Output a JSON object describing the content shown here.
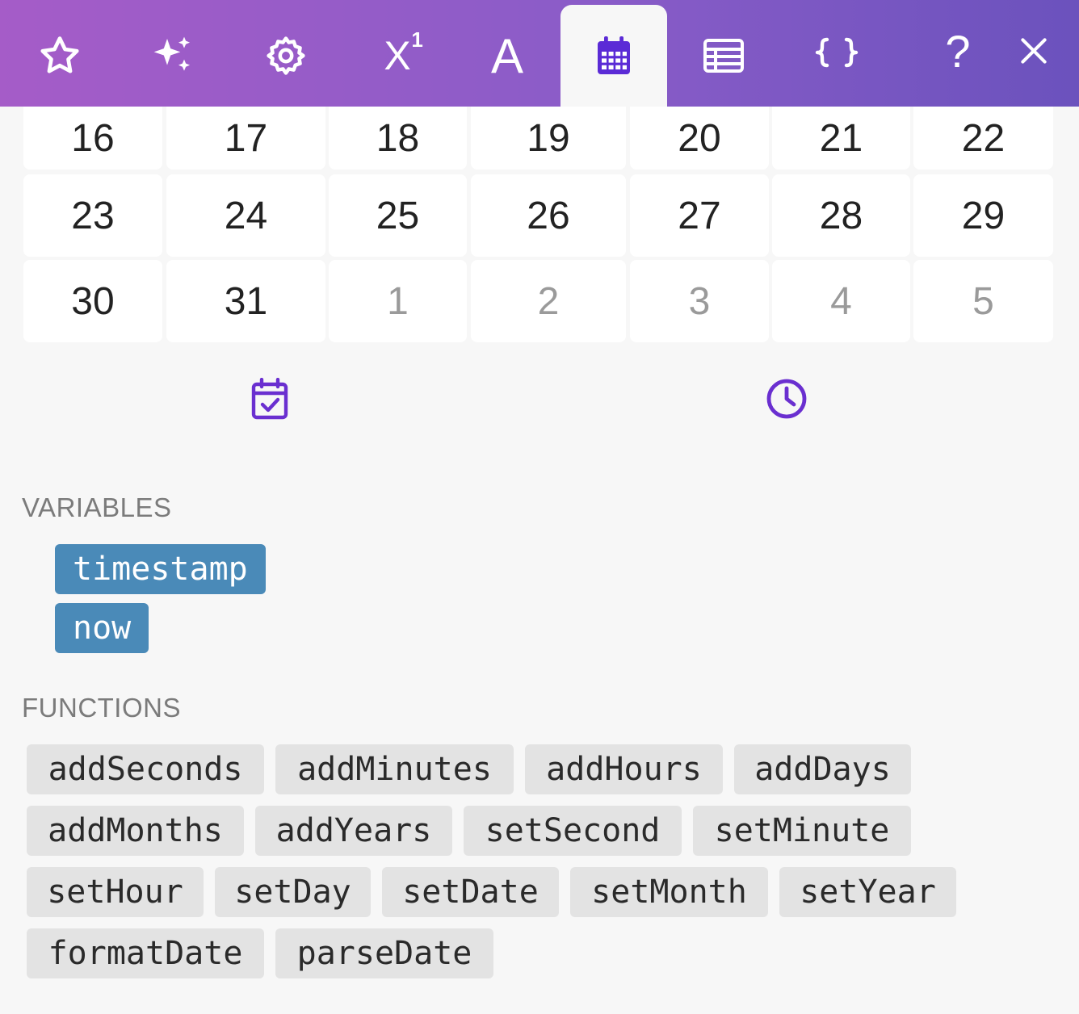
{
  "toolbar": {
    "tabs": [
      {
        "name": "favorites",
        "icon": "star-icon"
      },
      {
        "name": "ai",
        "icon": "sparkles-icon"
      },
      {
        "name": "settings",
        "icon": "gear-icon"
      },
      {
        "name": "math",
        "icon": "superscript-icon",
        "label": "X",
        "sup": "1"
      },
      {
        "name": "text",
        "icon": "text-icon",
        "label": "A"
      },
      {
        "name": "date",
        "icon": "calendar-icon",
        "active": true
      },
      {
        "name": "table",
        "icon": "table-icon"
      },
      {
        "name": "json",
        "icon": "braces-icon",
        "label": "{ }"
      },
      {
        "name": "help",
        "icon": "question-icon",
        "label": "?"
      },
      {
        "name": "close",
        "icon": "close-icon"
      }
    ],
    "active_color": "#5b2bd6"
  },
  "calendar": {
    "rows": [
      [
        {
          "day": "16",
          "muted": false
        },
        {
          "day": "17",
          "muted": false
        },
        {
          "day": "18",
          "muted": false
        },
        {
          "day": "19",
          "muted": false
        },
        {
          "day": "20",
          "muted": false
        },
        {
          "day": "21",
          "muted": false
        },
        {
          "day": "22",
          "muted": false
        }
      ],
      [
        {
          "day": "23",
          "muted": false
        },
        {
          "day": "24",
          "muted": false
        },
        {
          "day": "25",
          "muted": false
        },
        {
          "day": "26",
          "muted": false
        },
        {
          "day": "27",
          "muted": false
        },
        {
          "day": "28",
          "muted": false
        },
        {
          "day": "29",
          "muted": false
        }
      ],
      [
        {
          "day": "30",
          "muted": false
        },
        {
          "day": "31",
          "muted": false
        },
        {
          "day": "1",
          "muted": true
        },
        {
          "day": "2",
          "muted": true
        },
        {
          "day": "3",
          "muted": true
        },
        {
          "day": "4",
          "muted": true
        },
        {
          "day": "5",
          "muted": true
        }
      ]
    ],
    "picker_icons": [
      "calendar-check-icon",
      "clock-icon"
    ]
  },
  "variables": {
    "heading": "VARIABLES",
    "items": [
      "timestamp",
      "now"
    ],
    "chip_color": "#4a8ab8"
  },
  "functions": {
    "heading": "FUNCTIONS",
    "rows": [
      [
        "addSeconds",
        "addMinutes",
        "addHours",
        "addDays"
      ],
      [
        "addMonths",
        "addYears",
        "setSecond",
        "setMinute"
      ],
      [
        "setHour",
        "setDay",
        "setDate",
        "setMonth",
        "setYear"
      ],
      [
        "formatDate",
        "parseDate"
      ]
    ]
  }
}
